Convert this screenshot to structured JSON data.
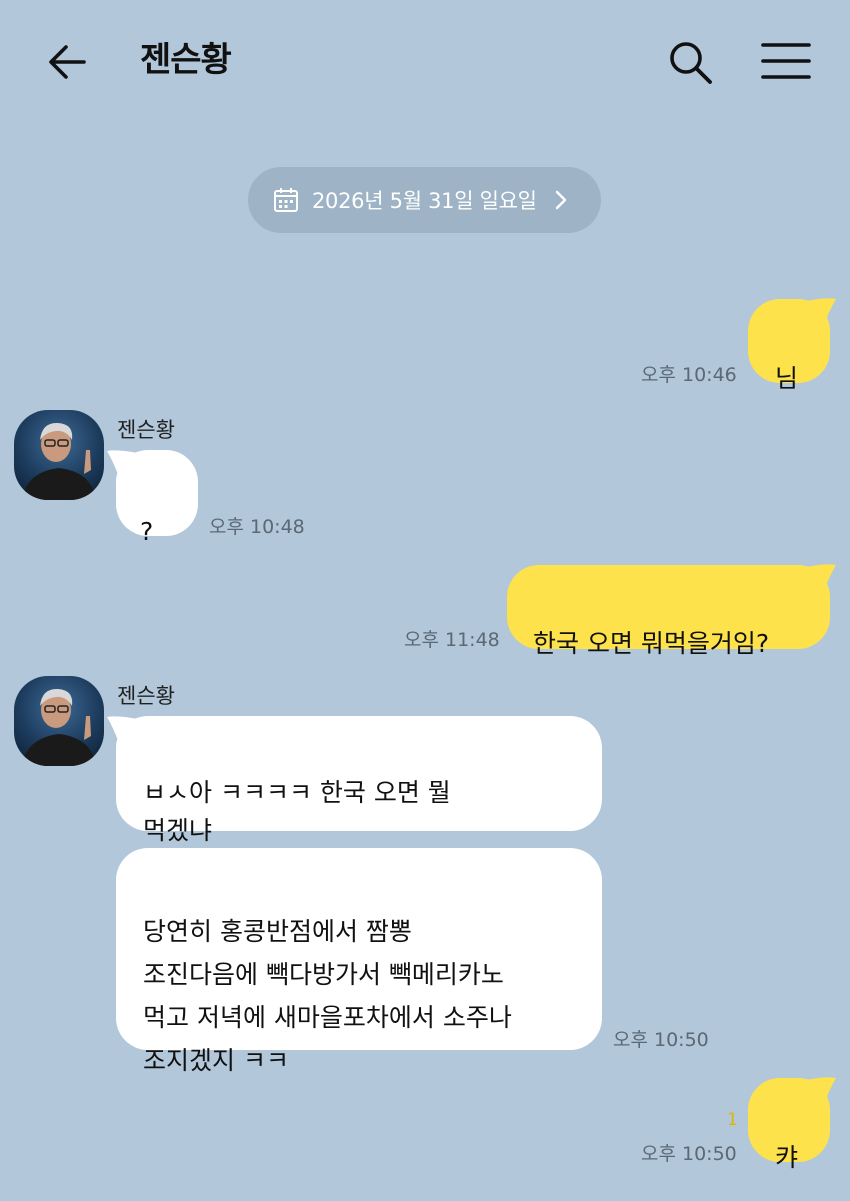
{
  "header": {
    "title": "젠슨황"
  },
  "date_divider": {
    "label": "2026년 5월 31일 일요일"
  },
  "messages": [
    {
      "sender": "me",
      "text": "님",
      "time": "오후 10:46"
    },
    {
      "sender": "젠슨황",
      "text": "?",
      "time": "오후 10:48"
    },
    {
      "sender": "me",
      "text": "한국 오면 뭐먹을거임?",
      "time": "오후 11:48"
    },
    {
      "sender": "젠슨황",
      "text": "ㅂㅅ아 ㅋㅋㅋㅋ 한국 오면 뭘\n먹겠냐",
      "time": ""
    },
    {
      "sender": "젠슨황",
      "text": "당연히 홍콩반점에서 짬뽕\n조진다음에 빽다방가서 빽메리카노\n먹고 저녁에 새마을포차에서 소주나\n조지겠지 ㅋㅋ",
      "time": "오후 10:50"
    },
    {
      "sender": "me",
      "text": "캬",
      "time": "오후 10:50",
      "unread": "1"
    }
  ],
  "colors": {
    "background": "#b2c7da",
    "my_bubble": "#fde24c",
    "their_bubble": "#ffffff"
  }
}
